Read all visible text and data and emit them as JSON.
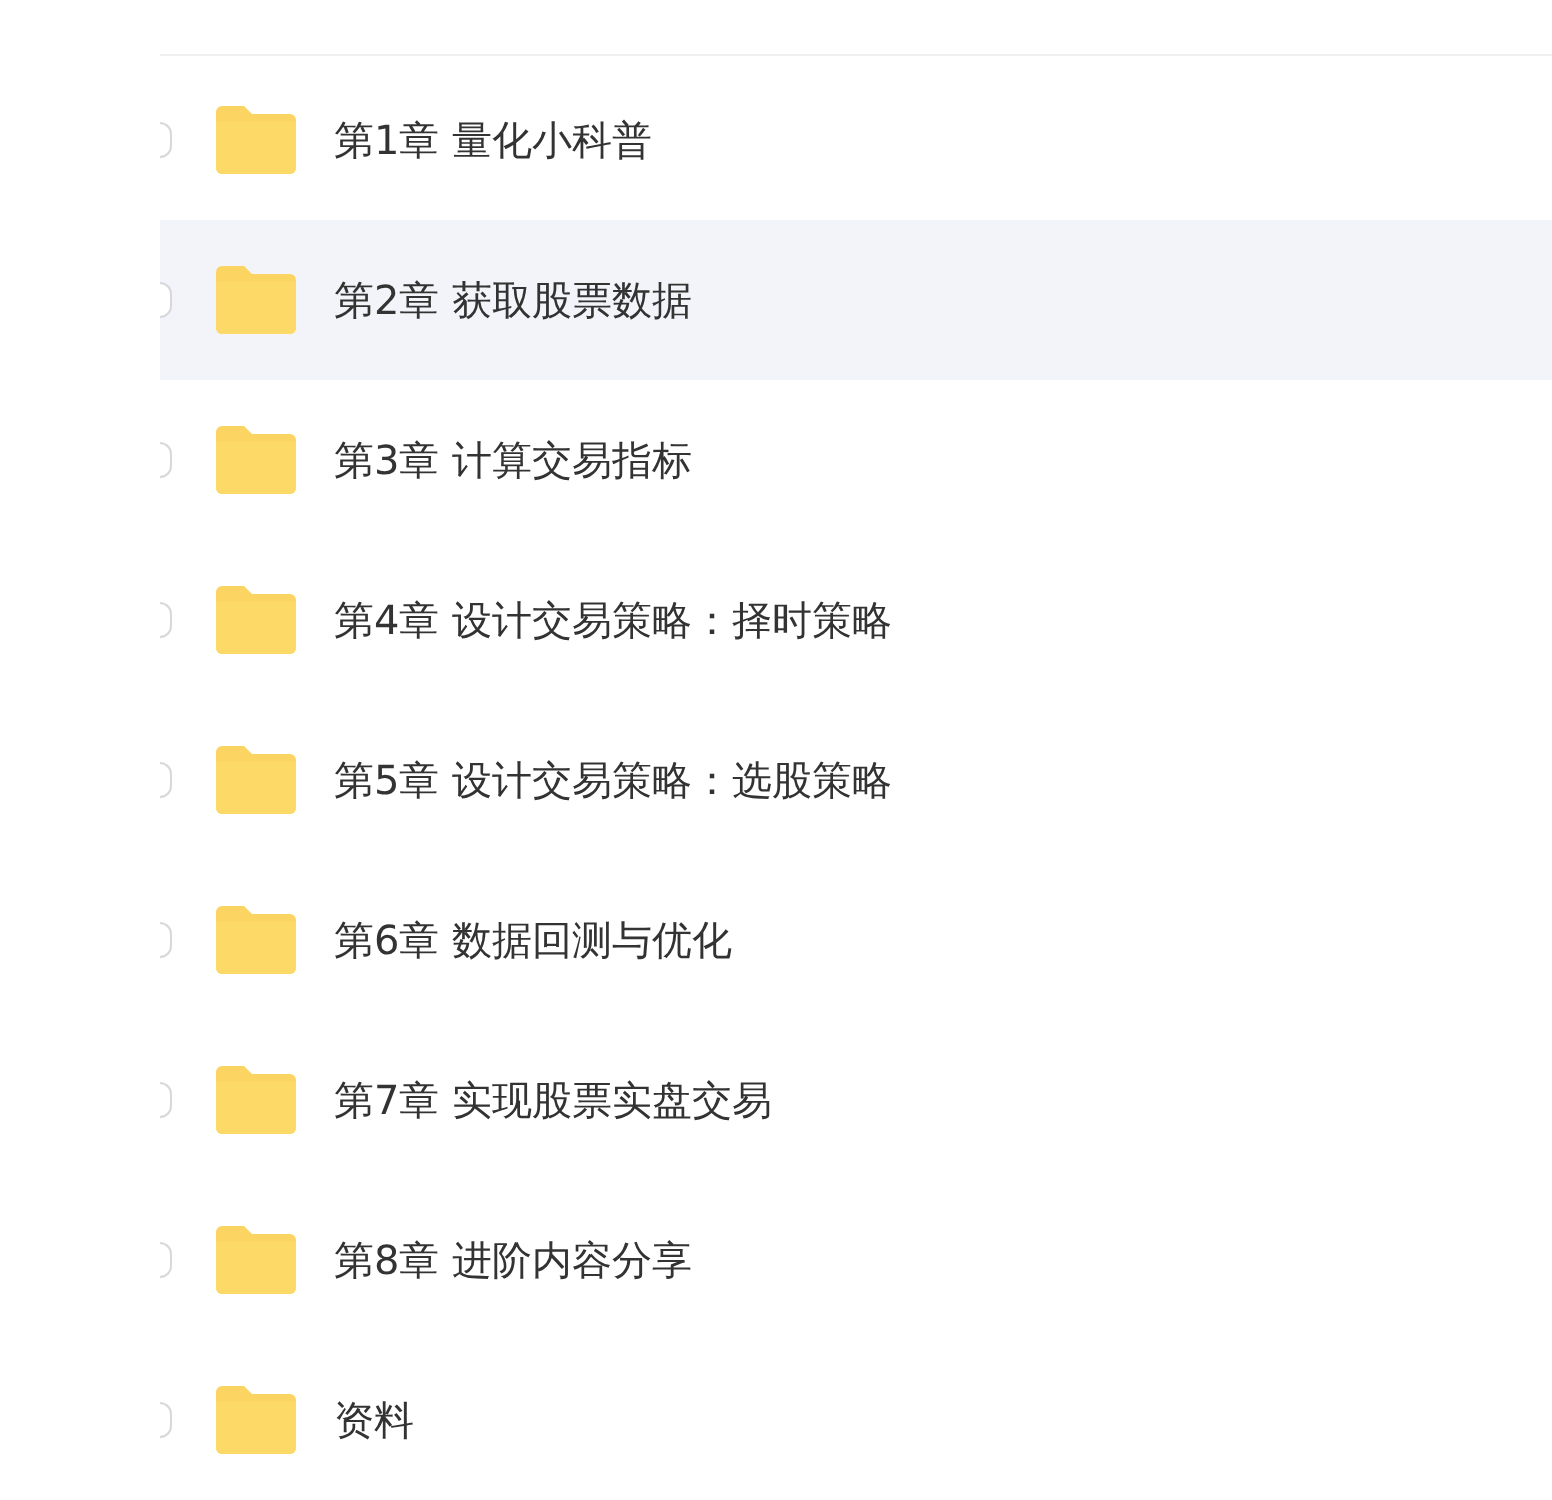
{
  "files": [
    {
      "name": "第1章 量化小科普",
      "checked": false,
      "highlighted": false
    },
    {
      "name": "第2章 获取股票数据",
      "checked": false,
      "highlighted": true
    },
    {
      "name": "第3章 计算交易指标",
      "checked": false,
      "highlighted": false
    },
    {
      "name": "第4章 设计交易策略：择时策略",
      "checked": false,
      "highlighted": false
    },
    {
      "name": "第5章 设计交易策略：选股策略",
      "checked": false,
      "highlighted": false
    },
    {
      "name": "第6章 数据回测与优化",
      "checked": false,
      "highlighted": false
    },
    {
      "name": "第7章 实现股票实盘交易",
      "checked": false,
      "highlighted": false
    },
    {
      "name": "第8章 进阶内容分享",
      "checked": false,
      "highlighted": false
    },
    {
      "name": "资料",
      "checked": false,
      "highlighted": false
    }
  ]
}
